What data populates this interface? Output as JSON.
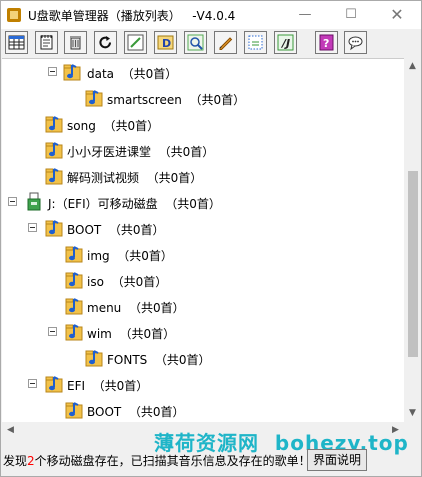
{
  "window": {
    "title": "U盘歌单管理器（播放列表）   -V4.0.4",
    "minimize_glyph": "—",
    "maximize_glyph": "☐",
    "close_glyph": "✕"
  },
  "toolbar": {
    "buttons": [
      {
        "icon": "grid-table-icon"
      },
      {
        "icon": "notepad-icon"
      },
      {
        "icon": "trash-icon"
      },
      {
        "icon": "refresh-icon"
      },
      {
        "icon": "edit-pencil-icon"
      },
      {
        "icon": "drive-d-icon"
      },
      {
        "icon": "search-dots-icon"
      },
      {
        "icon": "pencil-icon"
      },
      {
        "icon": "dotted-selection-icon"
      },
      {
        "icon": "italic-j-icon"
      },
      {
        "icon": "help-icon"
      },
      {
        "icon": "chat-bubble-icon"
      }
    ]
  },
  "tree": {
    "rows": [
      {
        "name": "data",
        "count": "（共0首）"
      },
      {
        "name": "smartscreen",
        "count": "（共0首）"
      },
      {
        "name": "song",
        "count": "（共0首）"
      },
      {
        "name": "小小牙医进课堂",
        "count": "（共0首）"
      },
      {
        "name": "解码测试视频",
        "count": "（共0首）"
      },
      {
        "name": "J:（EFI）可移动磁盘",
        "count": "（共0首）"
      },
      {
        "name": "BOOT",
        "count": "（共0首）"
      },
      {
        "name": "img",
        "count": "（共0首）"
      },
      {
        "name": "iso",
        "count": "（共0首）"
      },
      {
        "name": "menu",
        "count": "（共0首）"
      },
      {
        "name": "wim",
        "count": "（共0首）"
      },
      {
        "name": "FONTS",
        "count": "（共0首）"
      },
      {
        "name": "EFI",
        "count": "（共0首）"
      },
      {
        "name": "BOOT",
        "count": "（共0首）"
      }
    ]
  },
  "watermark": "薄荷资源网  bohezy.top",
  "status": {
    "prefix": "发现",
    "count": "2",
    "suffix": "个移动磁盘存在，已扫描其音乐信息及存在的歌单！",
    "help_button": "界面说明"
  },
  "colors": {
    "folder": "#f2c24a",
    "note": "#1e5fd0",
    "watermark": "#1fb5c8",
    "status_count": "#ff0000"
  }
}
